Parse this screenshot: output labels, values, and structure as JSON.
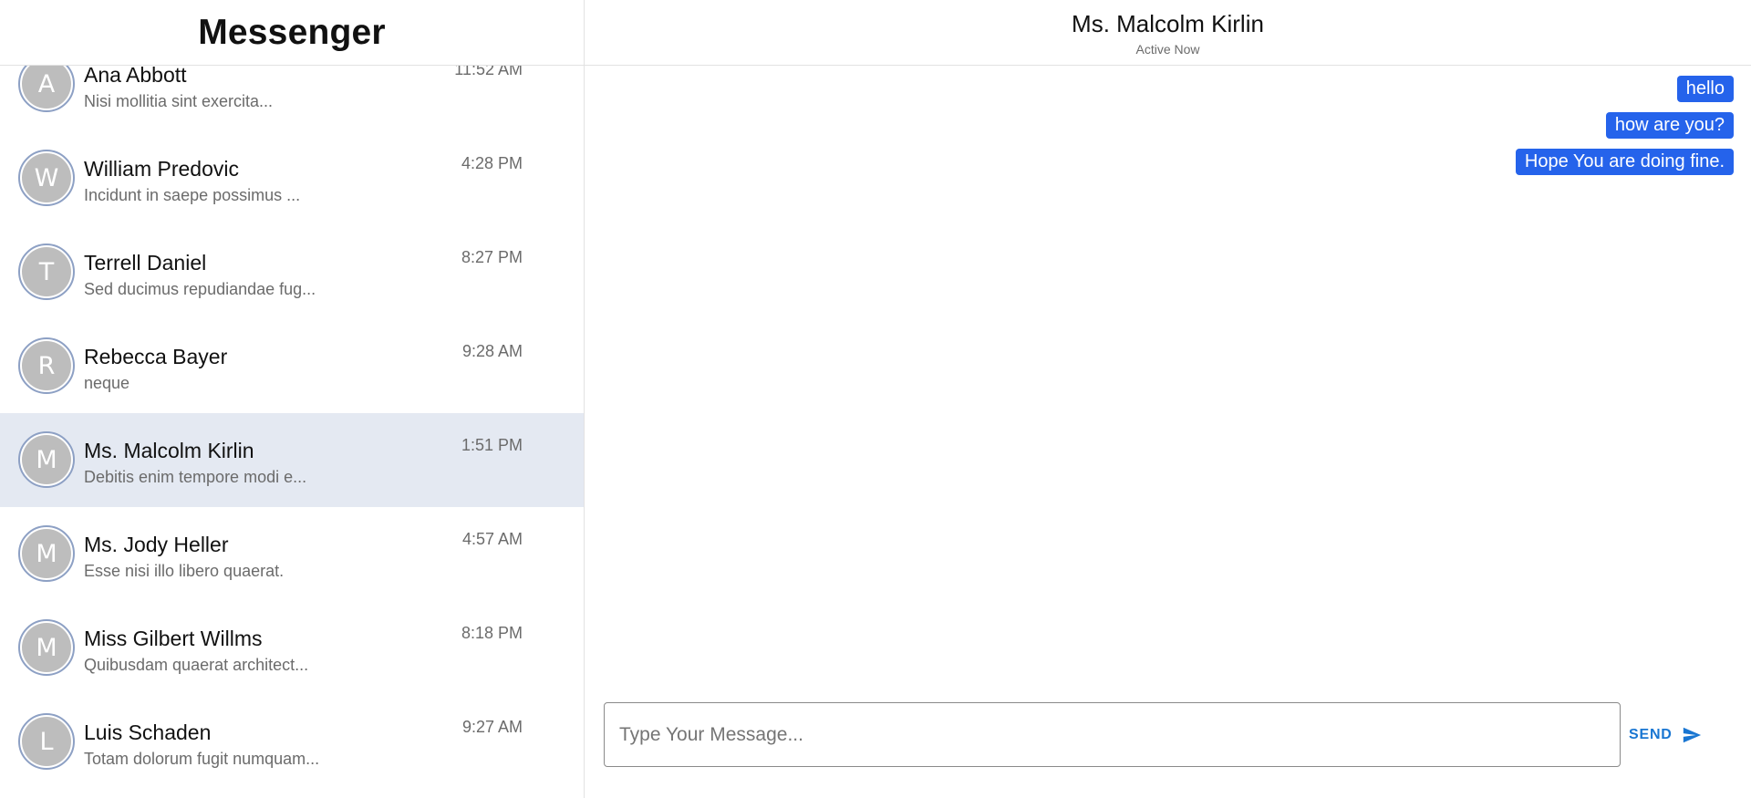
{
  "app": {
    "title": "Messenger"
  },
  "conversations": [
    {
      "initial": "A",
      "name": "Ana Abbott",
      "preview": "Nisi mollitia sint exercita...",
      "time": "11:52 AM",
      "selected": false
    },
    {
      "initial": "W",
      "name": "William Predovic",
      "preview": "Incidunt in saepe possimus ...",
      "time": "4:28 PM",
      "selected": false
    },
    {
      "initial": "T",
      "name": "Terrell Daniel",
      "preview": "Sed ducimus repudiandae fug...",
      "time": "8:27 PM",
      "selected": false
    },
    {
      "initial": "R",
      "name": "Rebecca Bayer",
      "preview": "neque",
      "time": "9:28 AM",
      "selected": false
    },
    {
      "initial": "M",
      "name": "Ms. Malcolm Kirlin",
      "preview": "Debitis enim tempore modi e...",
      "time": "1:51 PM",
      "selected": true
    },
    {
      "initial": "M",
      "name": "Ms. Jody Heller",
      "preview": "Esse nisi illo libero quaerat.",
      "time": "4:57 AM",
      "selected": false
    },
    {
      "initial": "M",
      "name": "Miss Gilbert Willms",
      "preview": "Quibusdam quaerat architect...",
      "time": "8:18 PM",
      "selected": false
    },
    {
      "initial": "L",
      "name": "Luis Schaden",
      "preview": "Totam dolorum fugit numquam...",
      "time": "9:27 AM",
      "selected": false
    }
  ],
  "chat": {
    "name": "Ms. Malcolm Kirlin",
    "status": "Active Now",
    "messages": [
      "hello",
      "how are you?",
      "Hope You are doing fine."
    ]
  },
  "composer": {
    "placeholder": "Type Your Message...",
    "value": "",
    "send_label": "SEND",
    "send_icon": "send-icon"
  },
  "colors": {
    "accent": "#2563eb",
    "send": "#1976d2",
    "selected_row": "#e4e9f2",
    "avatar_bg": "#bdbdbd",
    "avatar_ring": "#8da0c4"
  }
}
